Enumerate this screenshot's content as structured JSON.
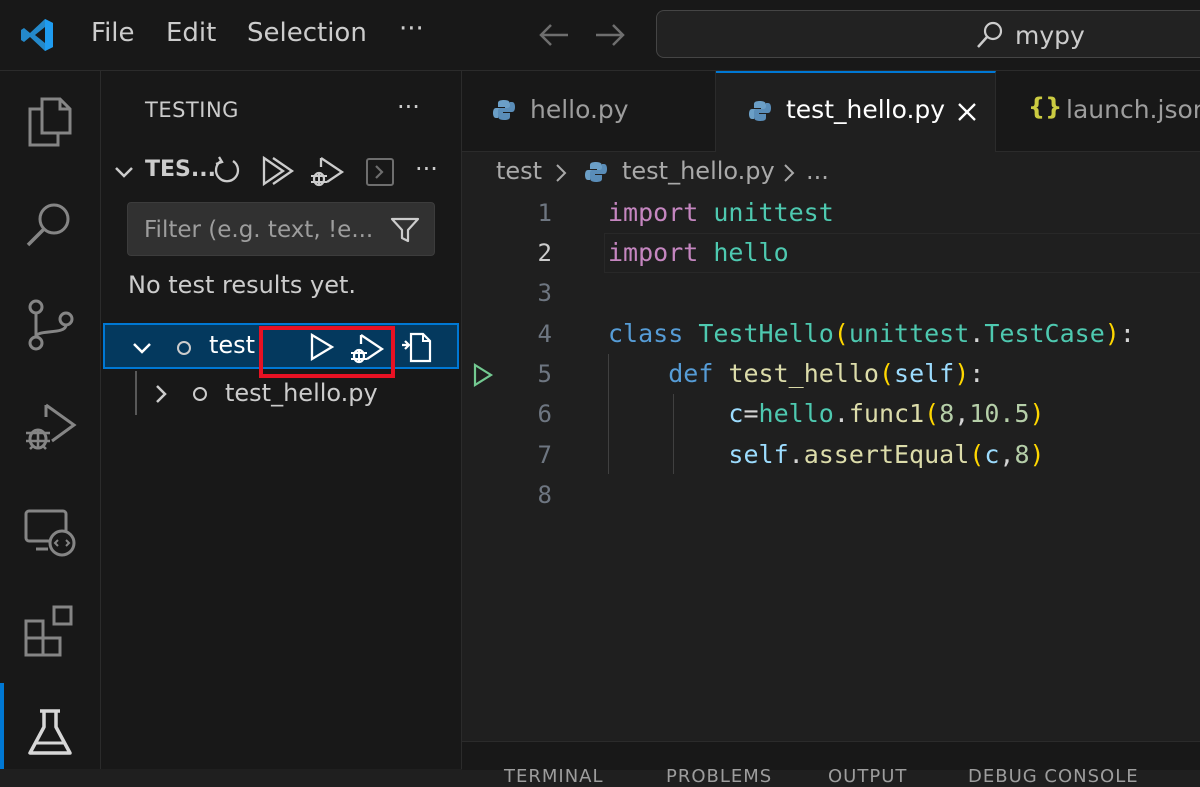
{
  "menu": {
    "file": "File",
    "edit": "Edit",
    "selection": "Selection",
    "more": "···"
  },
  "command_center": {
    "text": "mypy"
  },
  "sidebar": {
    "title": "TESTING",
    "more": "···",
    "section_title": "TES...",
    "filter_placeholder": "Filter (e.g. text, !e...",
    "status": "No test results yet.",
    "tree": [
      {
        "label": "test",
        "expanded": true
      },
      {
        "label": "test_hello.py",
        "expanded": false
      }
    ]
  },
  "tabs": [
    {
      "label": "hello.py",
      "icon": "python-icon"
    },
    {
      "label": "test_hello.py",
      "icon": "python-icon",
      "active": true
    },
    {
      "label": "launch.json",
      "icon": "json-braces-icon",
      "icon_text": "{}"
    }
  ],
  "breadcrumb": {
    "folder": "test",
    "file": "test_hello.py",
    "more": "..."
  },
  "code": {
    "line_numbers": [
      "1",
      "2",
      "3",
      "4",
      "5",
      "6",
      "7",
      "8"
    ],
    "l1_kw": "import",
    "l1_mod": "unittest",
    "l2_kw": "import",
    "l2_mod": "hello",
    "l4_kw": "class",
    "l4_name": "TestHello",
    "l4_base_mod": "unittest",
    "l4_base_cls": "TestCase",
    "l5_kw": "def",
    "l5_name": "test_hello",
    "l5_self": "self",
    "l6_var": "c",
    "l6_mod": "hello",
    "l6_fn": "func1",
    "l6_a1": "8",
    "l6_a2": "10.5",
    "l7_self": "self",
    "l7_fn": "assertEqual",
    "l7_a1": "c",
    "l7_a2": "8"
  },
  "panel_tabs": [
    "TERMINAL",
    "PROBLEMS",
    "OUTPUT",
    "DEBUG CONSOLE"
  ],
  "colors": {
    "accent": "#0078d4",
    "highlight": "#e81123",
    "run_gutter": "#73c991"
  }
}
